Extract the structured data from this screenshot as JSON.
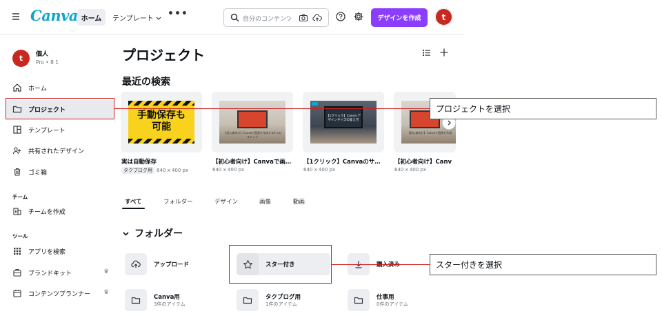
{
  "header": {
    "logo": "Canva",
    "nav_home": "ホーム",
    "nav_templates": "テンプレート",
    "more": "•••",
    "search_placeholder": "自分のコンテンツ",
    "create_button": "デザインを作成",
    "avatar_initial": "t"
  },
  "sidebar": {
    "user_initial": "t",
    "user_name": "個人",
    "user_plan": "Pro • 8 1",
    "items": [
      {
        "label": "ホーム",
        "icon": "home-icon"
      },
      {
        "label": "プロジェクト",
        "icon": "folder-icon"
      },
      {
        "label": "テンプレート",
        "icon": "template-icon"
      },
      {
        "label": "共有されたデザイン",
        "icon": "shared-icon"
      },
      {
        "label": "ゴミ箱",
        "icon": "trash-icon"
      }
    ],
    "team_section": "チーム",
    "team_item": "チームを作成",
    "tools_section": "ツール",
    "tools": [
      {
        "label": "アプリを検索",
        "icon": "apps-grid-icon"
      },
      {
        "label": "ブランドキット",
        "icon": "brand-kit-icon"
      },
      {
        "label": "コンテンツプランナー",
        "icon": "calendar-icon"
      }
    ]
  },
  "main": {
    "title": "プロジェクト",
    "recent_title": "最近の検索",
    "cards": [
      {
        "thumb_text": "手動保存も\n可能",
        "name": "実は自動保存",
        "tag": "タクブログ用",
        "size": "640 x 400 px"
      },
      {
        "thumb_caption": "【初心者向け】Canvaで画面を作成する5つのステップ",
        "name": "【初心者向け】Canvaで画…",
        "tag": "",
        "size": "640 x 400 px"
      },
      {
        "thumb_caption": "【1クリック】Canva デザインサイズの変え方",
        "name": "【1クリック】Canvaのサ…",
        "tag": "",
        "size": "640 x 400 px"
      },
      {
        "thumb_caption": "【初心者向け】Canvaで画面を作成",
        "name": "【初心者向け】Canv",
        "tag": "",
        "size": "640 x 400 px"
      }
    ],
    "tabs": [
      "すべて",
      "フォルダー",
      "デザイン",
      "画像",
      "動画"
    ],
    "folders_title": "フォルダー",
    "folders": [
      {
        "name": "アップロード",
        "meta": "",
        "icon": "cloud-upload-icon"
      },
      {
        "name": "スター付き",
        "meta": "",
        "icon": "star-icon"
      },
      {
        "name": "購入済み",
        "meta": "",
        "icon": "download-icon"
      },
      {
        "name": "Canva用",
        "meta": "3件のアイテム",
        "icon": "folder-icon"
      },
      {
        "name": "タクブログ用",
        "meta": "1件のアイテム",
        "icon": "folder-icon"
      },
      {
        "name": "仕事用",
        "meta": "0件のアイテム",
        "icon": "folder-icon"
      }
    ]
  },
  "annotations": {
    "callout_1": "プロジェクトを選択",
    "callout_2": "スター付きを選択",
    "color": "#d21d1d"
  },
  "colors": {
    "brand": "#8b3dff",
    "logo": "#10a5c9",
    "avatar": "#c8281e"
  }
}
